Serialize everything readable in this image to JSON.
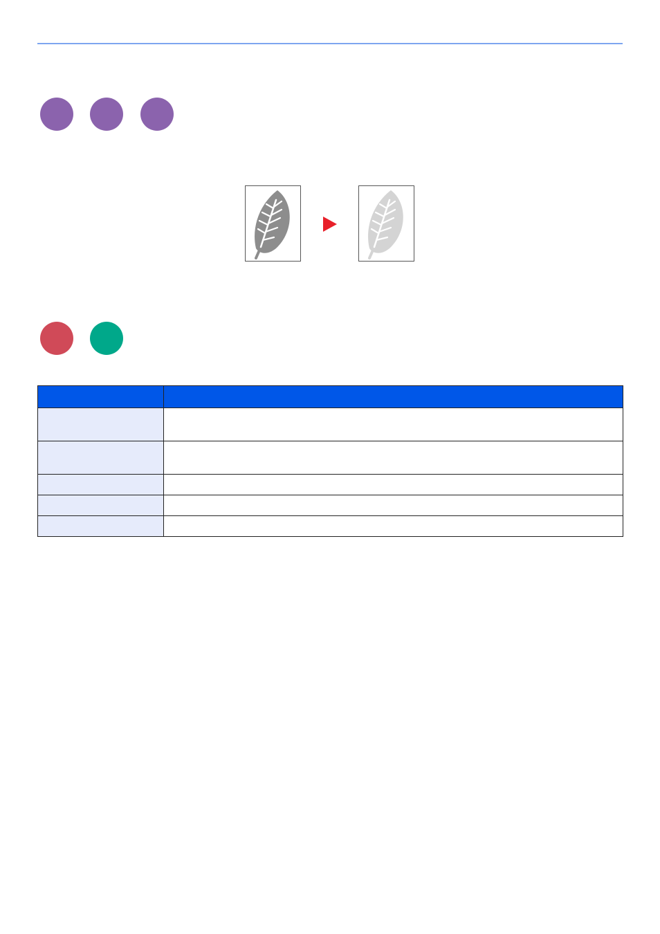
{
  "colors": {
    "rule": "#7ea6f0",
    "purple_circle": "#8b63ad",
    "red_circle": "#d04a58",
    "green_circle": "#00a88a",
    "arrow": "#e8202a",
    "table_header": "#0057e8",
    "item_cell": "#e6ebfb"
  },
  "icons": {
    "mode_badges": [
      "purple-circle-icon",
      "purple-circle-icon",
      "purple-circle-icon"
    ],
    "type_badges": [
      "red-circle-icon",
      "green-circle-icon"
    ],
    "illustration": [
      "leaf-page-dark-icon",
      "arrow-right-icon",
      "leaf-page-light-icon"
    ]
  },
  "table": {
    "header": {
      "item": "",
      "description": ""
    },
    "rows": [
      {
        "item": "",
        "description": "",
        "size": "tall"
      },
      {
        "item": "",
        "description": "",
        "size": "tall"
      },
      {
        "item": "",
        "description": "",
        "size": "short"
      },
      {
        "item": "",
        "description": "",
        "size": "short"
      },
      {
        "item": "",
        "description": "",
        "size": "short"
      }
    ]
  }
}
